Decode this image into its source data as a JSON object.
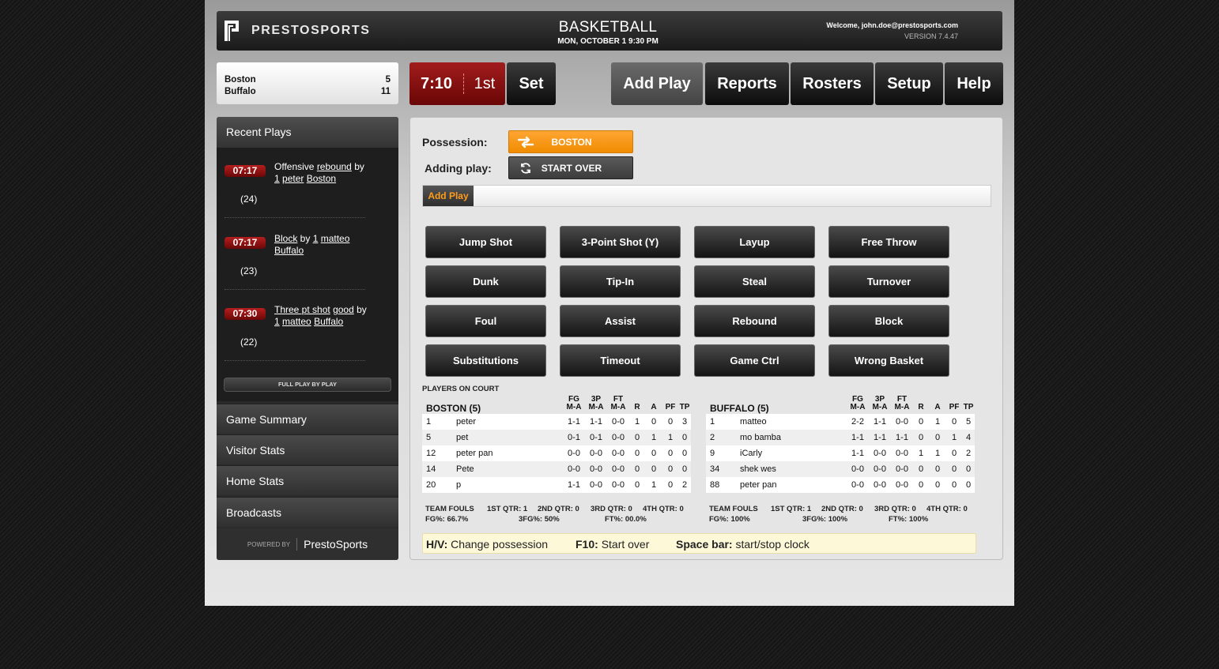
{
  "header": {
    "logo_text": "PRESTOSPORTS",
    "sport": "BASKETBALL",
    "datetime": "MON, OCTOBER 1 9:30 PM",
    "welcome": "Welcome, john.doe@prestosports.com",
    "version": "VERSION 7.4.47"
  },
  "score": {
    "rows": [
      {
        "team": "Boston",
        "score": "5"
      },
      {
        "team": "Buffalo",
        "score": "11"
      }
    ]
  },
  "clock": {
    "time": "7:10",
    "period": "1st",
    "set_label": "Set"
  },
  "nav": {
    "add_play": "Add Play",
    "reports": "Reports",
    "rosters": "Rosters",
    "setup": "Setup",
    "help": "Help"
  },
  "sidebar": {
    "recent_title": "Recent Plays",
    "plays": [
      {
        "time": "07:17",
        "parts": [
          [
            "Offensive ",
            false
          ],
          [
            "rebound",
            true
          ],
          [
            " by ",
            false
          ],
          [
            "1",
            true
          ],
          [
            " ",
            false
          ],
          [
            "peter",
            true
          ],
          [
            " ",
            false
          ],
          [
            "Boston",
            true
          ]
        ],
        "num": "(24)"
      },
      {
        "time": "07:17",
        "parts": [
          [
            "Block",
            true
          ],
          [
            " by ",
            false
          ],
          [
            "1",
            true
          ],
          [
            " ",
            false
          ],
          [
            "matteo",
            true
          ],
          [
            " ",
            false
          ],
          [
            "Buffalo",
            true
          ]
        ],
        "num": "(23)"
      },
      {
        "time": "07:30",
        "parts": [
          [
            "Three pt shot",
            true
          ],
          [
            " ",
            false
          ],
          [
            "good",
            true
          ],
          [
            " by ",
            false
          ],
          [
            "1",
            true
          ],
          [
            " ",
            false
          ],
          [
            "matteo",
            true
          ],
          [
            " ",
            false
          ],
          [
            "Buffalo",
            true
          ]
        ],
        "num": "(22)"
      }
    ],
    "full_pbp": "FULL PLAY BY PLAY",
    "items": [
      "Game Summary",
      "Visitor Stats",
      "Home Stats",
      "Broadcasts"
    ],
    "powered_by": "POWERED BY",
    "brand": "PrestoSports"
  },
  "main": {
    "possession_label": "Possession:",
    "possession_team": "BOSTON",
    "adding_label": "Adding play:",
    "start_over": "START OVER",
    "tab": "Add Play",
    "play_buttons": [
      [
        "Jump Shot",
        "3-Point Shot (Y)",
        "Layup",
        "Free Throw"
      ],
      [
        "Dunk",
        "Tip-In",
        "Steal",
        "Turnover"
      ],
      [
        "Foul",
        "Assist",
        "Rebound",
        "Block"
      ],
      [
        "Substitutions",
        "Timeout",
        "Game Ctrl",
        "Wrong Basket"
      ]
    ],
    "players_on_court": "PLAYERS ON COURT",
    "stat_headers": {
      "top": [
        "FG",
        "3P",
        "FT"
      ],
      "bottom": [
        "M-A",
        "M-A",
        "M-A",
        "R",
        "A",
        "PF",
        "TP"
      ]
    },
    "teams": [
      {
        "name": "BOSTON (5)",
        "players": [
          [
            "1",
            "peter",
            "1-1",
            "1-1",
            "0-0",
            "1",
            "0",
            "0",
            "3"
          ],
          [
            "5",
            "pet",
            "0-1",
            "0-1",
            "0-0",
            "0",
            "1",
            "1",
            "0"
          ],
          [
            "12",
            "peter pan",
            "0-0",
            "0-0",
            "0-0",
            "0",
            "0",
            "0",
            "0"
          ],
          [
            "14",
            "Pete",
            "0-0",
            "0-0",
            "0-0",
            "0",
            "0",
            "0",
            "0"
          ],
          [
            "20",
            "p",
            "1-1",
            "0-0",
            "0-0",
            "0",
            "1",
            "0",
            "2"
          ]
        ],
        "fouls": {
          "label": "TEAM FOULS",
          "q1": "1ST QTR: 1",
          "q2": "2ND QTR: 0",
          "q3": "3RD QTR: 0",
          "q4": "4TH QTR: 0"
        },
        "pct": {
          "fg": "FG%:  66.7%",
          "fg3": "3FG%:  50%",
          "ft": "FT%:  00.0%"
        }
      },
      {
        "name": "BUFFALO (5)",
        "players": [
          [
            "1",
            "matteo",
            "2-2",
            "1-1",
            "0-0",
            "0",
            "1",
            "0",
            "5"
          ],
          [
            "2",
            "mo bamba",
            "1-1",
            "1-1",
            "1-1",
            "0",
            "0",
            "1",
            "4"
          ],
          [
            "9",
            "iCarly",
            "1-1",
            "0-0",
            "0-0",
            "1",
            "1",
            "0",
            "2"
          ],
          [
            "34",
            "shek wes",
            "0-0",
            "0-0",
            "0-0",
            "0",
            "0",
            "0",
            "0"
          ],
          [
            "88",
            "peter pan",
            "0-0",
            "0-0",
            "0-0",
            "0",
            "0",
            "0",
            "0"
          ]
        ],
        "fouls": {
          "label": "TEAM FOULS",
          "q1": "1ST QTR: 1",
          "q2": "2ND QTR: 0",
          "q3": "3RD QTR: 0",
          "q4": "4TH QTR: 0"
        },
        "pct": {
          "fg": "FG%:  100%",
          "fg3": "3FG%:  100%",
          "ft": "FT%:  100%"
        }
      }
    ],
    "hints": {
      "k1": "H/V:",
      "v1": "Change possession",
      "k2": "F10:",
      "v2": "Start over",
      "k3": "Space bar:",
      "v3": "start/stop clock"
    }
  }
}
